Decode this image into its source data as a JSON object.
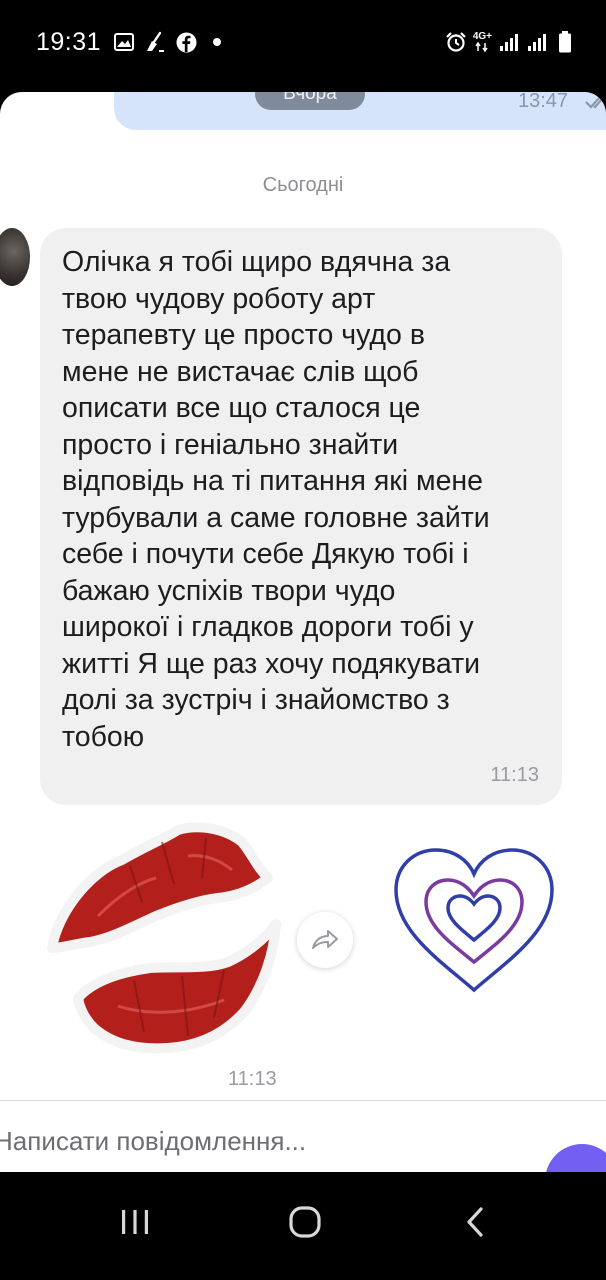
{
  "status_bar": {
    "time": "19:31",
    "network": "4G+",
    "left_icons": [
      "gallery-icon",
      "broom-icon",
      "facebook-icon",
      "dot-icon"
    ],
    "right_icons": [
      "alarm-icon",
      "signal-icon",
      "signal-icon",
      "battery-icon"
    ]
  },
  "chat": {
    "previous_message": {
      "day_chip": "Вчора",
      "time": "13:47"
    },
    "day_separator": "Сьогодні",
    "incoming_message": {
      "text": "Олічка я тобі щиро вдячна за\nтвою чудову роботу арт\nтерапевту це просто чудо в\nмене не вистачає слів щоб\nописати все що сталося це\nпросто і геніально знайти\nвідповідь на ті питання які мене\nтурбували а саме головне зайти\nсебе і почути себе Дякую тобі і\nбажаю успіхів  твори чудо\nширокої і гладков дороги тобі у\nжитті Я ще раз хочу подякувати\nдолі за зустріч і знайомство з\nтобою",
      "time": "11:13"
    },
    "sticker_message": {
      "stickers": [
        "lips-sticker",
        "heart-sticker"
      ],
      "time": "11:13"
    }
  },
  "compose": {
    "placeholder": "Написати повідомлення..."
  },
  "nav_bar": {
    "buttons": [
      "recent-apps",
      "home",
      "back"
    ]
  },
  "colors": {
    "accent": "#7360f2",
    "outgoing_bubble": "#d5e4fb",
    "incoming_bubble": "#f0f0f1",
    "lips": "#b3201c"
  }
}
